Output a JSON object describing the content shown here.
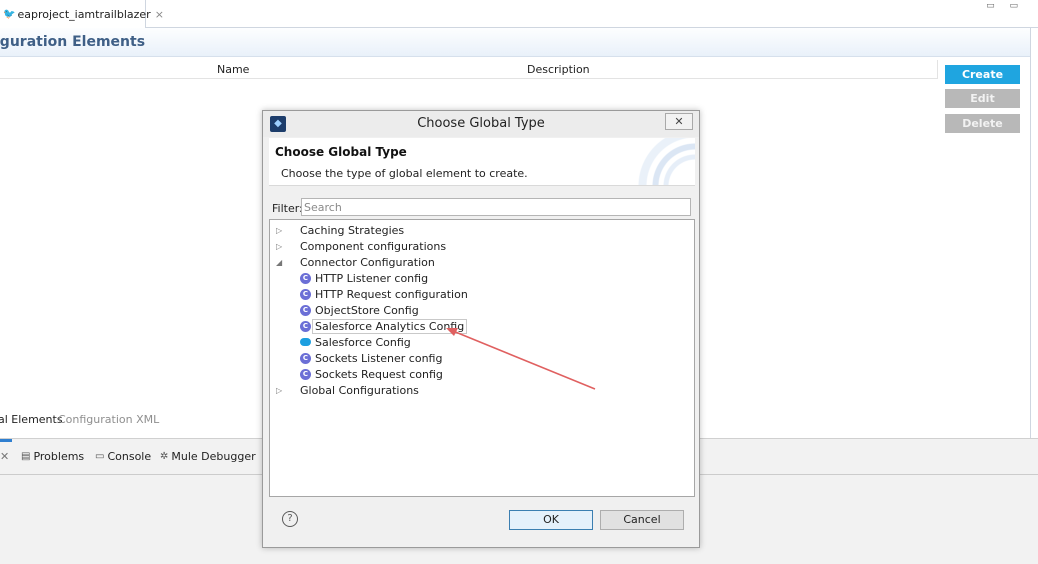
{
  "editor_tab": {
    "title": "eaproject_iamtrailblazer",
    "close": "×"
  },
  "window_controls": "▭ ▭",
  "section": {
    "title": "iguration Elements"
  },
  "table": {
    "columns": [
      "Name",
      "Description"
    ]
  },
  "side_buttons": {
    "create": "Create",
    "edit": "Edit",
    "delete": "Delete"
  },
  "editor_bottom_tabs": {
    "active": "al Elements",
    "inactive": "Configuration XML"
  },
  "bottom_tabs": [
    {
      "label": "Problems",
      "icon": "problems-icon"
    },
    {
      "label": "Console",
      "icon": "console-icon"
    },
    {
      "label": "Mule Debugger",
      "icon": "debugger-icon"
    }
  ],
  "dialog": {
    "title": "Choose Global Type",
    "close": "✕",
    "banner_title": "Choose Global Type",
    "banner_desc": "Choose the type of global element to create.",
    "filter_label": "Filter:",
    "filter_placeholder": "Search",
    "tree": [
      {
        "label": "Caching Strategies",
        "expanded": false,
        "children": []
      },
      {
        "label": "Component configurations",
        "expanded": false,
        "children": []
      },
      {
        "label": "Connector Configuration",
        "expanded": true,
        "children": [
          {
            "label": "HTTP Listener config",
            "icon": "connector-icon"
          },
          {
            "label": "HTTP Request configuration",
            "icon": "connector-icon"
          },
          {
            "label": "ObjectStore Config",
            "icon": "connector-icon"
          },
          {
            "label": "Salesforce Analytics Config",
            "icon": "connector-icon",
            "selected": true
          },
          {
            "label": "Salesforce Config",
            "icon": "salesforce-cloud-icon"
          },
          {
            "label": "Sockets Listener config",
            "icon": "connector-icon"
          },
          {
            "label": "Sockets Request config",
            "icon": "connector-icon"
          }
        ]
      },
      {
        "label": "Global Configurations",
        "expanded": false,
        "children": []
      }
    ],
    "help": "?",
    "ok": "OK",
    "cancel": "Cancel"
  },
  "colors": {
    "create_button": "#1fa5e0",
    "disabled_button": "#b8b8b8",
    "annotation_arrow": "#e06060",
    "section_title": "#3f5f86"
  }
}
